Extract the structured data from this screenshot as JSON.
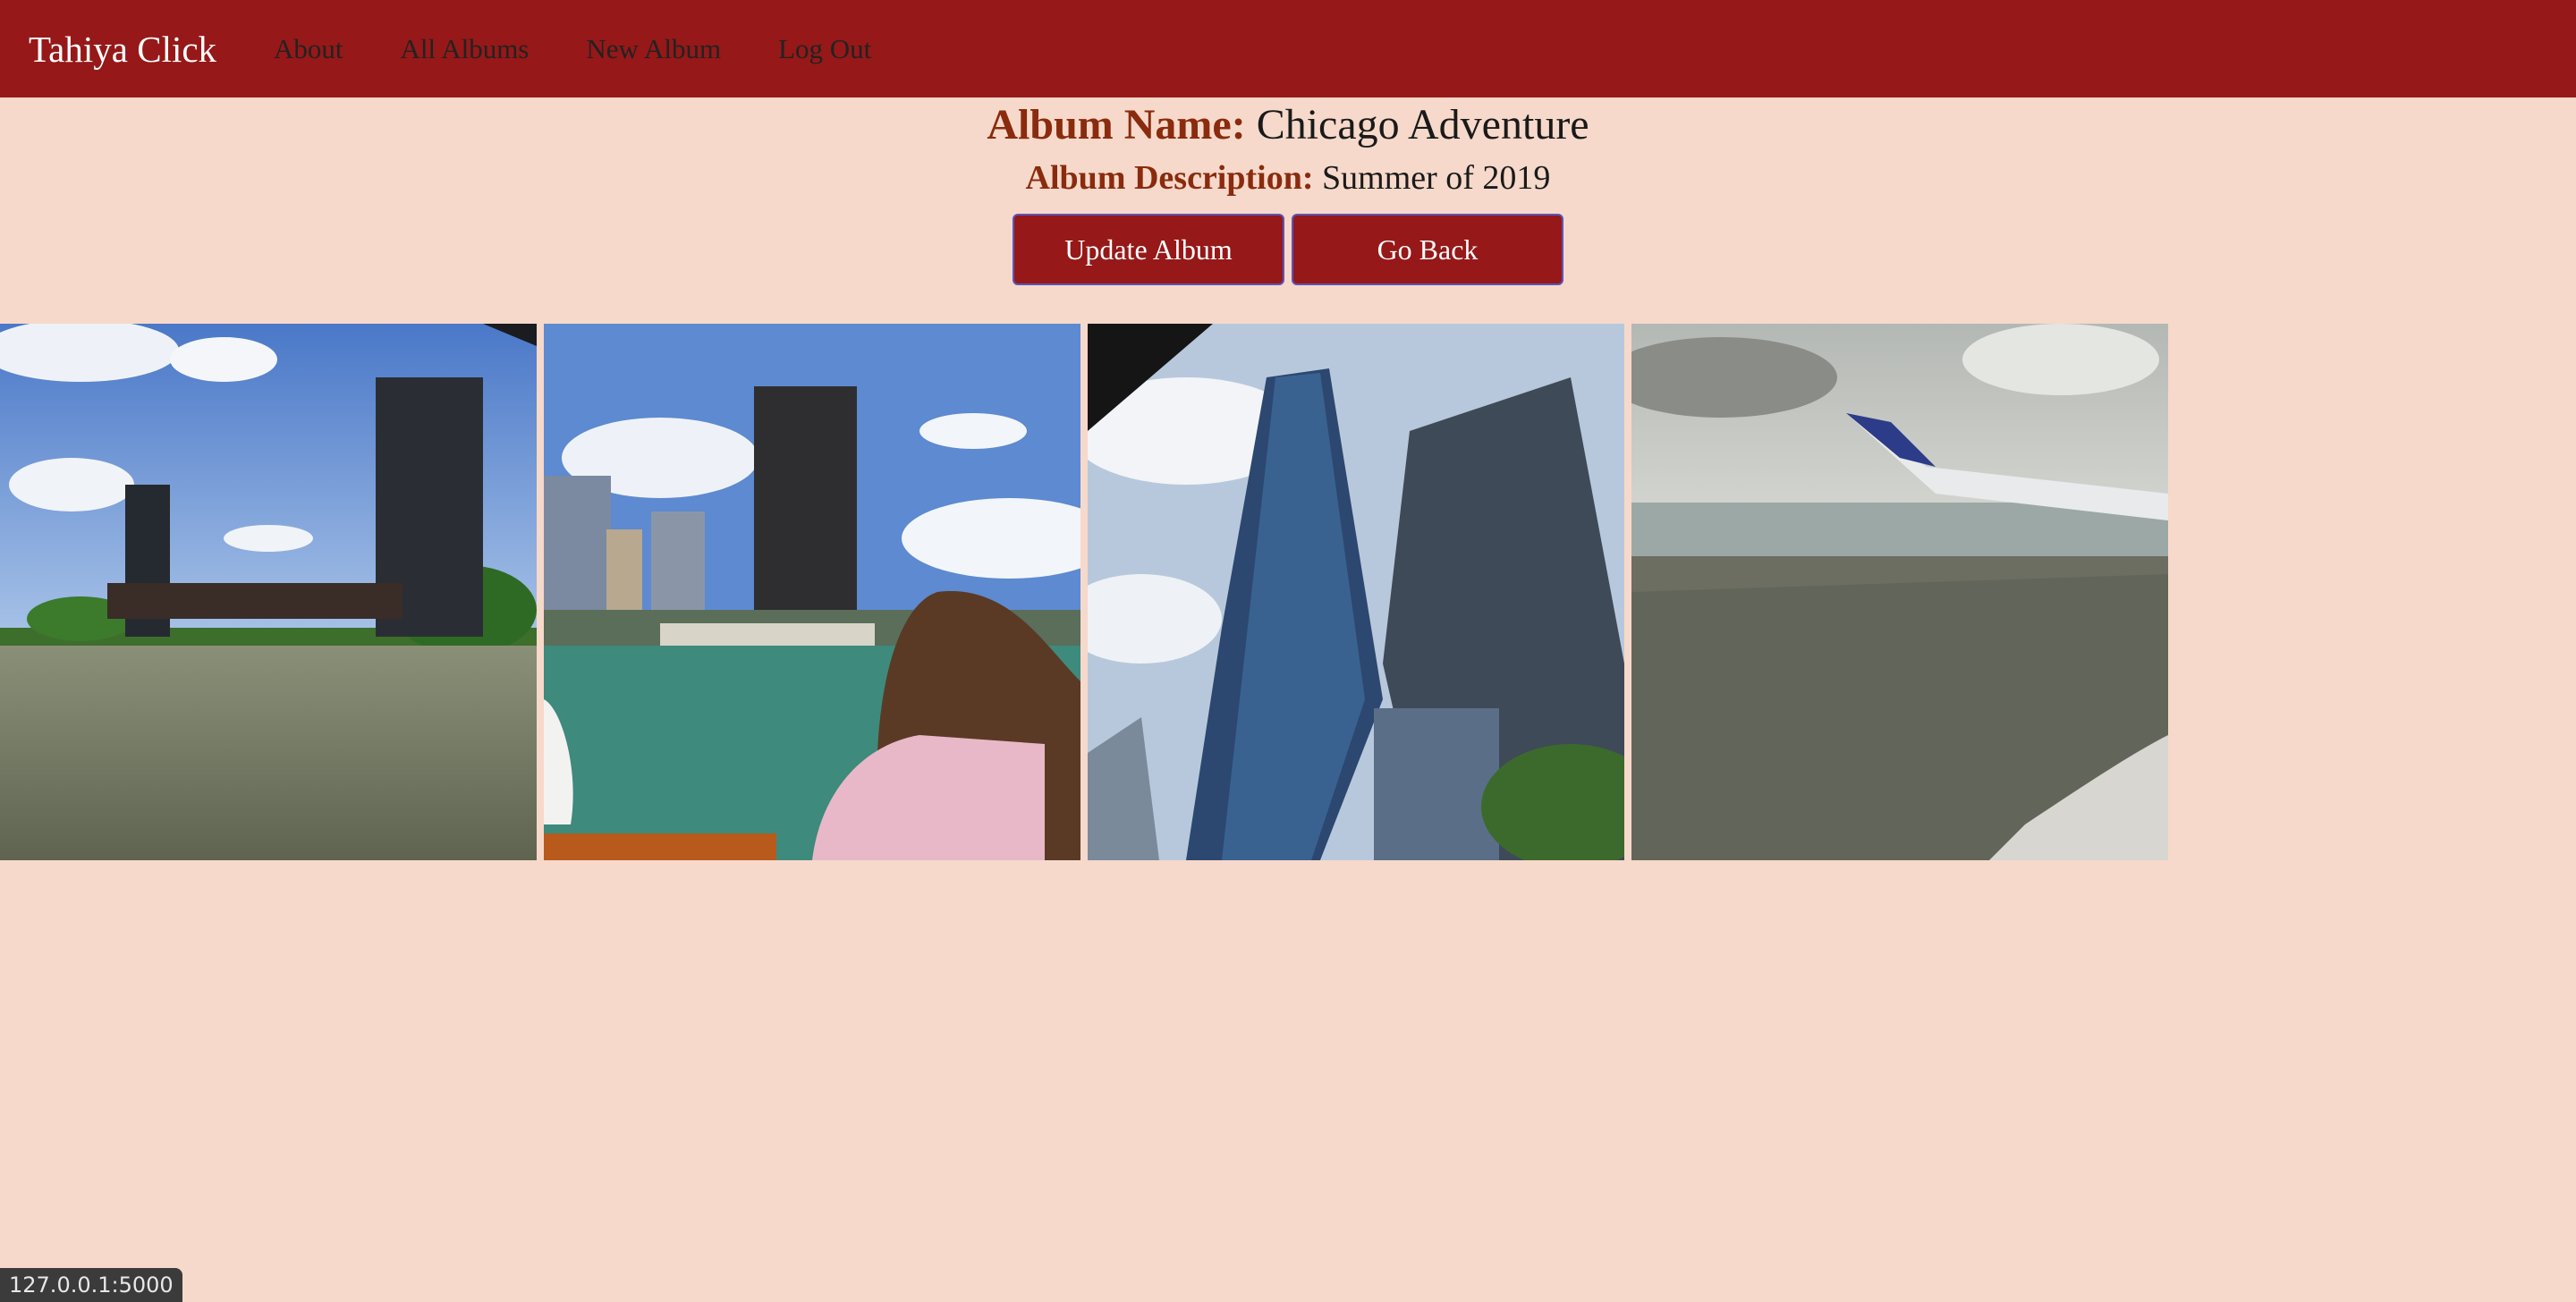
{
  "nav": {
    "brand": "Tahiya Click",
    "links": [
      "About",
      "All Albums",
      "New Album",
      "Log Out"
    ]
  },
  "album": {
    "name_label": "Album Name:",
    "name": "Chicago Adventure",
    "description_label": "Album Description:",
    "description": "Summer of 2019"
  },
  "buttons": {
    "update": "Update Album",
    "back": "Go Back"
  },
  "photos": [
    {
      "subject": "river-bridge-photo"
    },
    {
      "subject": "river-tower-photo"
    },
    {
      "subject": "skyscraper-photo"
    },
    {
      "subject": "airplane-window-photo"
    }
  ],
  "status_url": "127.0.0.1:5000",
  "colors": {
    "navbar": "#961818",
    "background": "#f6d9ca",
    "label": "#8a2b0e",
    "button_border": "#5a55b8"
  }
}
